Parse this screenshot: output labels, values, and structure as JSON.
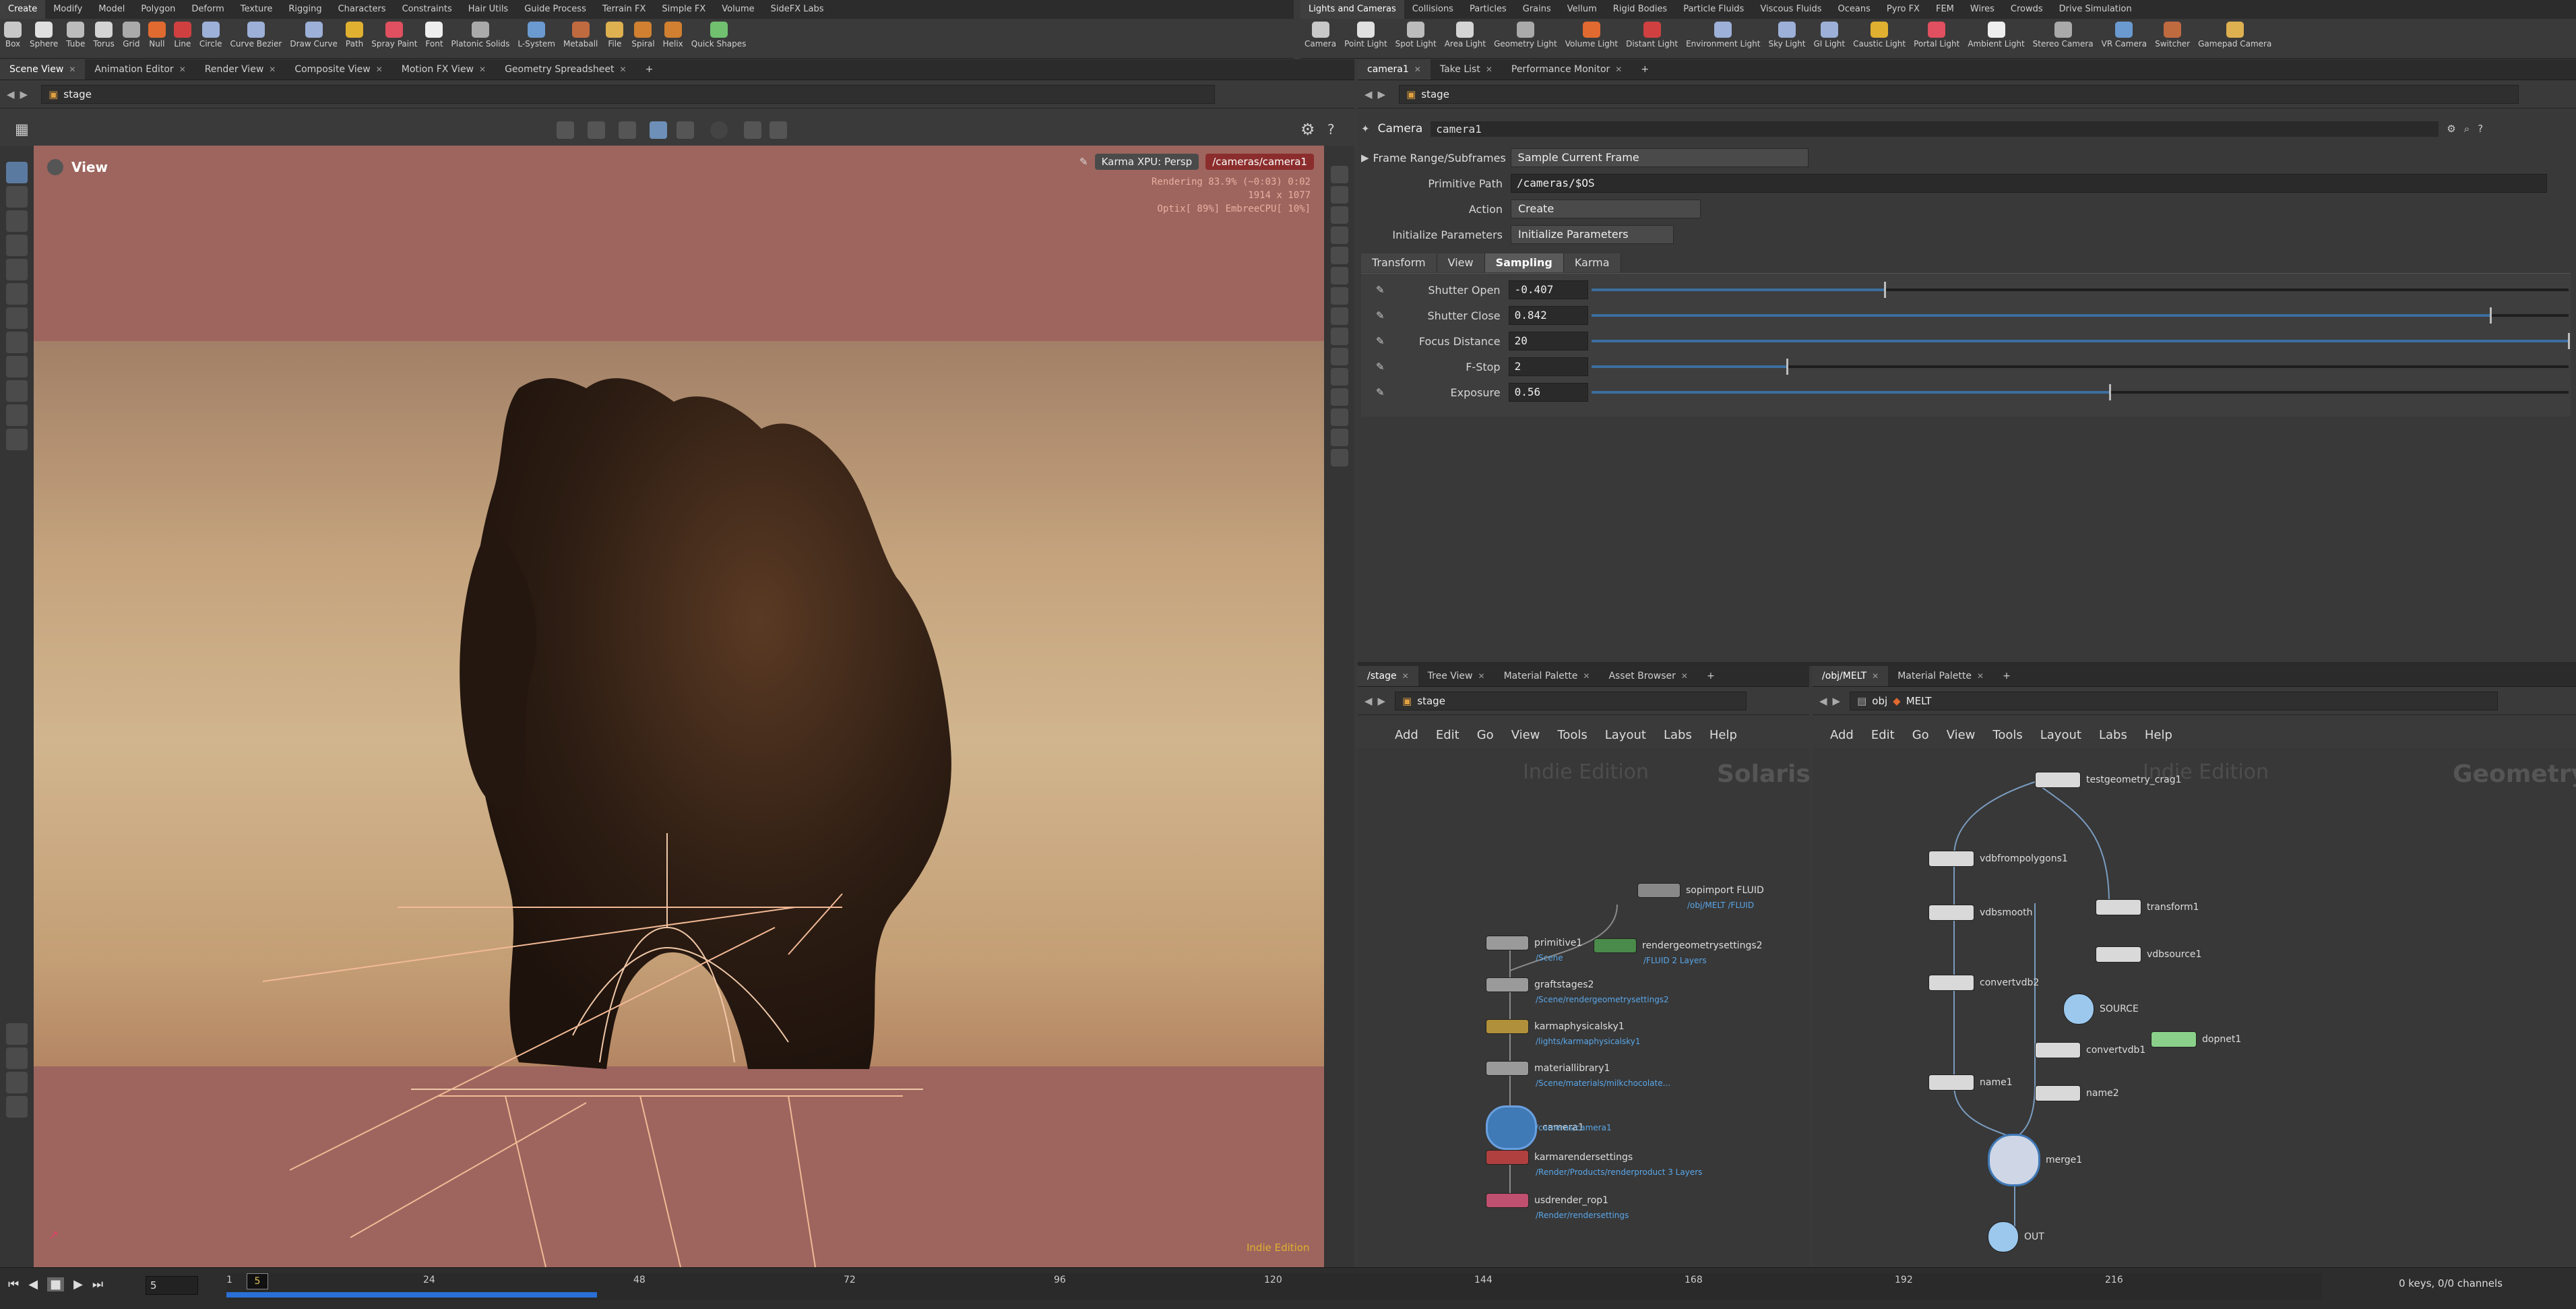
{
  "shelf_tabs_left": [
    "Create",
    "Modify",
    "Model",
    "Polygon",
    "Deform",
    "Texture",
    "Rigging",
    "Characters",
    "Constraints",
    "Hair Utils",
    "Guide Process",
    "Terrain FX",
    "Simple FX",
    "Volume",
    "SideFX Labs"
  ],
  "shelf_tabs_right": [
    "Lights and Cameras",
    "Collisions",
    "Particles",
    "Grains",
    "Vellum",
    "Rigid Bodies",
    "Particle Fluids",
    "Viscous Fluids",
    "Oceans",
    "Pyro FX",
    "FEM",
    "Wires",
    "Crowds",
    "Drive Simulation"
  ],
  "tools_left": [
    "Box",
    "Sphere",
    "Tube",
    "Torus",
    "Grid",
    "Null",
    "Line",
    "Circle",
    "Curve Bezier",
    "Draw Curve",
    "Path",
    "Spray Paint",
    "Font",
    "Platonic Solids",
    "L-System",
    "Metaball",
    "File",
    "Spiral",
    "Helix",
    "Quick Shapes"
  ],
  "tools_right": [
    "Camera",
    "Point Light",
    "Spot Light",
    "Area Light",
    "Geometry Light",
    "Volume Light",
    "Distant Light",
    "Environment Light",
    "Sky Light",
    "GI Light",
    "Caustic Light",
    "Portal Light",
    "Ambient Light",
    "Stereo Camera",
    "VR Camera",
    "Switcher",
    "Gamepad Camera"
  ],
  "left_tabs": [
    "Scene View",
    "Animation Editor",
    "Render View",
    "Composite View",
    "Motion FX View",
    "Geometry Spreadsheet"
  ],
  "right_tabs": [
    "camera1",
    "Take List",
    "Performance Monitor"
  ],
  "path_left": "stage",
  "path_right": "stage",
  "viewport": {
    "title": "View",
    "renderer": "Karma XPU: Persp",
    "camera": "/cameras/camera1",
    "stats_line1": "Rendering  83.9%  (~0:03)  0:02",
    "stats_line2": "1914 x 1077",
    "stats_line3": "Optix[ 89%] EmbreeCPU[ 10%]",
    "edition": "Indie Edition"
  },
  "params": {
    "node_type": "Camera",
    "node_name": "camera1",
    "frame_range_label": "Frame Range/Subframes",
    "frame_range_value": "Sample Current Frame",
    "prim_path_label": "Primitive Path",
    "prim_path_value": "/cameras/$OS",
    "action_label": "Action",
    "action_value": "Create",
    "init_label": "Initialize Parameters",
    "init_value": "Initialize Parameters",
    "tabs": [
      "Transform",
      "View",
      "Sampling",
      "Karma"
    ],
    "rows": [
      {
        "label": "Shutter Open",
        "value": "-0.407",
        "slider": 0.3
      },
      {
        "label": "Shutter Close",
        "value": "0.842",
        "slider": 0.92
      },
      {
        "label": "Focus Distance",
        "value": "20",
        "slider": 1.0
      },
      {
        "label": "F-Stop",
        "value": "2",
        "slider": 0.2
      },
      {
        "label": "Exposure",
        "value": "0.56",
        "slider": 0.53
      }
    ]
  },
  "net_left": {
    "tabs": [
      "/stage",
      "Tree View",
      "Material Palette",
      "Asset Browser"
    ],
    "path": "stage",
    "menu": [
      "Add",
      "Edit",
      "Go",
      "View",
      "Tools",
      "Layout",
      "Labs",
      "Help"
    ],
    "edition": "Indie Edition",
    "context": "Solaris",
    "nodes": [
      {
        "name": "sopimport FLUID",
        "sub": "/obj/MELT /FLUID"
      },
      {
        "name": "primitive1",
        "sub": "/Scene"
      },
      {
        "name": "rendergeometrysettings2",
        "sub": "/FLUID 2 Layers"
      },
      {
        "name": "graftstages2",
        "sub": "/Scene/rendergeometrysettings2"
      },
      {
        "name": "karmaphysicalsky1",
        "sub": "/lights/karmaphysicalsky1"
      },
      {
        "name": "materiallibrary1",
        "sub": "/Scene/materials/milkchocolate..."
      },
      {
        "name": "camera1",
        "sub": "/cameras/camera1"
      },
      {
        "name": "karmarendersettings",
        "sub": "/Render/Products/renderproduct 3 Layers"
      },
      {
        "name": "usdrender_rop1",
        "sub": "/Render/rendersettings"
      }
    ]
  },
  "net_right": {
    "tabs": [
      "/obj/MELT",
      "Material Palette"
    ],
    "path_obj": "obj",
    "path_node": "MELT",
    "menu": [
      "Add",
      "Edit",
      "Go",
      "View",
      "Tools",
      "Layout",
      "Labs",
      "Help"
    ],
    "edition": "Indie Edition",
    "context": "Geometry",
    "nodes": [
      "testgeometry_crag1",
      "vdbfrompolygons1",
      "vdbsmooth",
      "transform1",
      "vdbsource1",
      "convertvdb2",
      "SOURCE",
      "dopnet1",
      "convertvdb1",
      "name1",
      "name2",
      "merge1",
      "OUT"
    ]
  },
  "timeline": {
    "frame": "5",
    "ticks": [
      "1",
      "24",
      "48",
      "72",
      "96",
      "120",
      "144",
      "168",
      "192",
      "216"
    ],
    "keys_info": "0 keys, 0/0 channels",
    "current": "5"
  },
  "colors": {
    "accent": "#2a6fd6",
    "viewport_top": "#9d655e",
    "viewport_mid": "#c8a57c",
    "wire": "#e8b08a"
  }
}
